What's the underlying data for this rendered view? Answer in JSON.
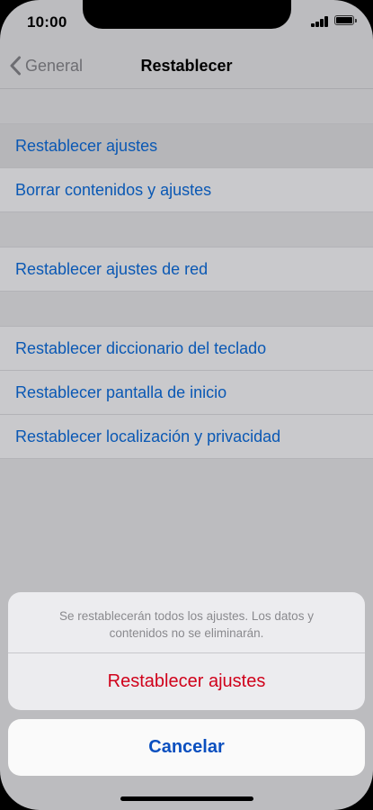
{
  "status_bar": {
    "time": "10:00",
    "icons": [
      "signal-icon",
      "battery-icon"
    ]
  },
  "nav": {
    "back_label": "General",
    "title": "Restablecer",
    "back_icon": "chevron-left-icon"
  },
  "groups": [
    {
      "items": [
        {
          "label": "Restablecer ajustes",
          "highlighted": true
        },
        {
          "label": "Borrar contenidos y ajustes"
        }
      ]
    },
    {
      "items": [
        {
          "label": "Restablecer ajustes de red"
        }
      ]
    },
    {
      "items": [
        {
          "label": "Restablecer diccionario del teclado"
        },
        {
          "label": "Restablecer pantalla de inicio"
        },
        {
          "label": "Restablecer localización y privacidad"
        }
      ]
    }
  ],
  "action_sheet": {
    "message_line1": "Se restablecerán todos los ajustes. Los datos y",
    "message_line2": "contenidos no se eliminarán.",
    "destructive_label": "Restablecer ajustes",
    "cancel_label": "Cancelar"
  },
  "colors": {
    "link_blue": "#0a58b4",
    "destructive_red": "#d0021b",
    "dimmed_background": "#bcbcbf"
  }
}
